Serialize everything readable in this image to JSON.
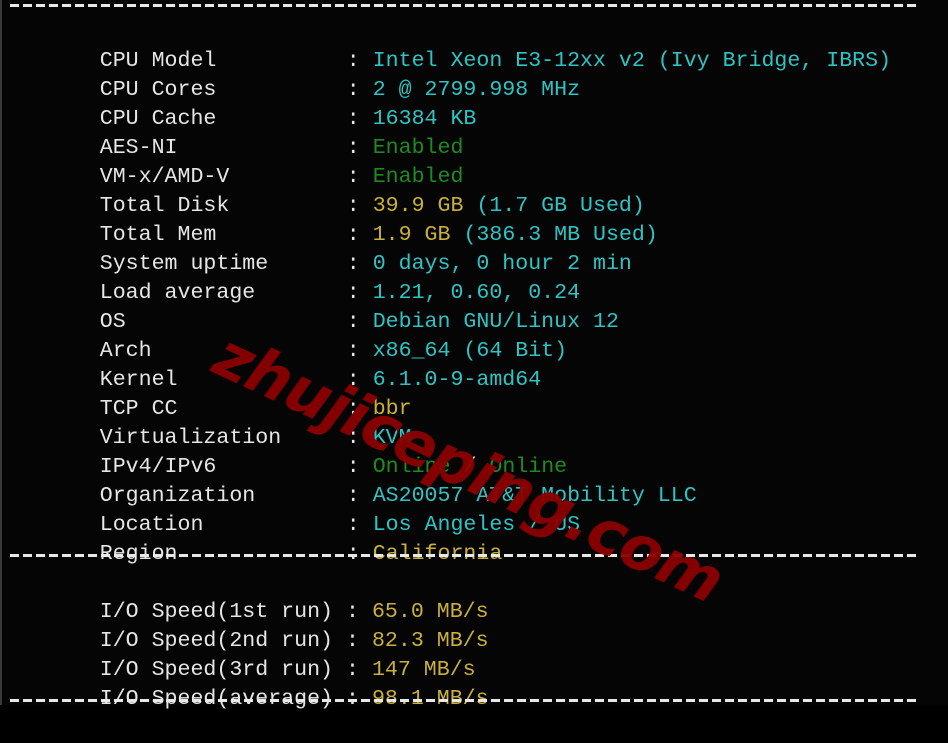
{
  "terminal": {
    "separator": "----------------------------------------------------------------------",
    "watermark": "zhujiceping.com",
    "colors": {
      "background": "#050505",
      "label": "#e6e6e6",
      "cyan": "#2ec4c4",
      "green": "#1f8a1f",
      "yellow": "#c9b13c",
      "watermark": "#8b0000"
    },
    "system_info": [
      {
        "label": "CPU Model",
        "value": "Intel Xeon E3-12xx v2 (Ivy Bridge, IBRS)"
      },
      {
        "label": "CPU Cores",
        "value": "2 @ 2799.998 MHz"
      },
      {
        "label": "CPU Cache",
        "value": "16384 KB"
      },
      {
        "label": "AES-NI",
        "value": "Enabled"
      },
      {
        "label": "VM-x/AMD-V",
        "value": "Enabled"
      },
      {
        "label": "Total Disk",
        "value_main": "39.9 GB",
        "value_detail": "(1.7 GB Used)"
      },
      {
        "label": "Total Mem",
        "value_main": "1.9 GB",
        "value_detail": "(386.3 MB Used)"
      },
      {
        "label": "System uptime",
        "value": "0 days, 0 hour 2 min"
      },
      {
        "label": "Load average",
        "value": "1.21, 0.60, 0.24"
      },
      {
        "label": "OS",
        "value": "Debian GNU/Linux 12"
      },
      {
        "label": "Arch",
        "value": "x86_64 (64 Bit)"
      },
      {
        "label": "Kernel",
        "value": "6.1.0-9-amd64"
      },
      {
        "label": "TCP CC",
        "value": "bbr"
      },
      {
        "label": "Virtualization",
        "value": "KVM"
      },
      {
        "label": "IPv4/IPv6",
        "value_ipv4": "Online",
        "value_slash": "/",
        "value_ipv6": "Online"
      },
      {
        "label": "Organization",
        "value": "AS20057 AT&T Mobility LLC"
      },
      {
        "label": "Location",
        "value": "Los Angeles / US"
      },
      {
        "label": "Region",
        "value": "California"
      }
    ],
    "io_speed": [
      {
        "label": "I/O Speed(1st run)",
        "value": "65.0 MB/s"
      },
      {
        "label": "I/O Speed(2nd run)",
        "value": "82.3 MB/s"
      },
      {
        "label": "I/O Speed(3rd run)",
        "value": "147 MB/s"
      },
      {
        "label": "I/O Speed(average)",
        "value": "98.1 MB/s"
      }
    ],
    "colon": ":"
  }
}
